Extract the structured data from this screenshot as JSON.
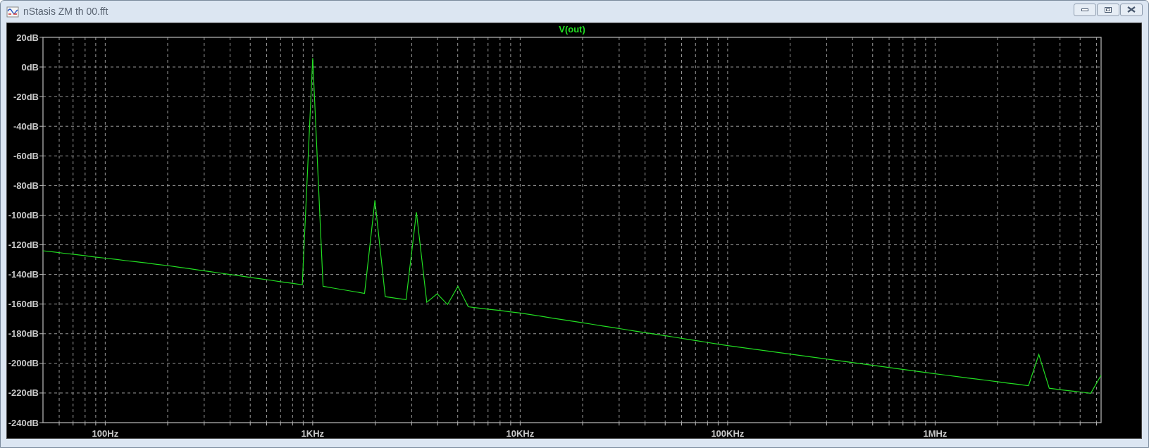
{
  "window": {
    "title": "nStasis ZM th 00.fft"
  },
  "plot": {
    "chart_data": {
      "type": "line",
      "grid": true,
      "ylim": [
        -240,
        20
      ],
      "yticks": [
        {
          "value": 20,
          "label": "20dB"
        },
        {
          "value": 0,
          "label": "0dB"
        },
        {
          "value": -20,
          "label": "-20dB"
        },
        {
          "value": -40,
          "label": "-40dB"
        },
        {
          "value": -60,
          "label": "-60dB"
        },
        {
          "value": -80,
          "label": "-80dB"
        },
        {
          "value": -100,
          "label": "-100dB"
        },
        {
          "value": -120,
          "label": "-120dB"
        },
        {
          "value": -140,
          "label": "-140dB"
        },
        {
          "value": -160,
          "label": "-160dB"
        },
        {
          "value": -180,
          "label": "-180dB"
        },
        {
          "value": -200,
          "label": "-200dB"
        },
        {
          "value": -220,
          "label": "-220dB"
        },
        {
          "value": -240,
          "label": "-240dB"
        }
      ],
      "categories": [
        null,
        null,
        null,
        null,
        null,
        null,
        "100Hz",
        null,
        null,
        null,
        null,
        null,
        null,
        null,
        null,
        null,
        null,
        null,
        null,
        null,
        null,
        null,
        null,
        null,
        null,
        null,
        "1KHz",
        null,
        null,
        null,
        null,
        null,
        null,
        null,
        null,
        null,
        null,
        null,
        null,
        null,
        null,
        null,
        null,
        null,
        null,
        null,
        "10KHz",
        null,
        null,
        null,
        null,
        null,
        null,
        null,
        null,
        null,
        null,
        null,
        null,
        null,
        null,
        null,
        null,
        null,
        null,
        null,
        "100KHz",
        null,
        null,
        null,
        null,
        null,
        null,
        null,
        null,
        null,
        null,
        null,
        null,
        null,
        null,
        null,
        null,
        null,
        null,
        null,
        "1MHz",
        null,
        null,
        null,
        null,
        null,
        null,
        null,
        null,
        null,
        null,
        null,
        null,
        null,
        null,
        null,
        null
      ],
      "series": [
        {
          "name": "V(out)",
          "color": "#22dd22",
          "values": [
            -124,
            -124.8,
            -125.7,
            -126.5,
            -127.3,
            -128.2,
            -129,
            -129.8,
            -130.7,
            -131.5,
            -132.3,
            -133.2,
            -134,
            -135,
            -136,
            -137,
            -138,
            -139,
            -140,
            -141,
            -142,
            -143,
            -144,
            -145,
            -146,
            -147,
            6,
            -148,
            -149.2,
            -150.4,
            -151.6,
            -152.8,
            -90,
            -155,
            -156,
            -157,
            -98,
            -158.8,
            -153,
            -160.3,
            -148,
            -161.8,
            -162.7,
            -163.5,
            -164.3,
            -165.2,
            -166,
            -167.1,
            -168.2,
            -169.3,
            -170.4,
            -171.5,
            -172.6,
            -173.7,
            -174.8,
            -175.9,
            -177,
            -178.1,
            -179.2,
            -180.3,
            -181.4,
            -182.5,
            -183.6,
            -184.7,
            -185.8,
            -186.9,
            -188,
            -189,
            -189.9,
            -190.9,
            -191.8,
            -192.8,
            -193.7,
            -194.7,
            -195.6,
            -196.6,
            -197.5,
            -198.5,
            -199.4,
            -200.4,
            -201.3,
            -202.3,
            -203.2,
            -204.2,
            -205.1,
            -206.1,
            -207,
            -207.9,
            -208.8,
            -209.7,
            -210.6,
            -211.5,
            -212.4,
            -213.3,
            -214.2,
            -215.1,
            -194,
            -216.8,
            -217.7,
            -218.5,
            -219.3,
            -220.2,
            -208
          ]
        }
      ]
    }
  }
}
